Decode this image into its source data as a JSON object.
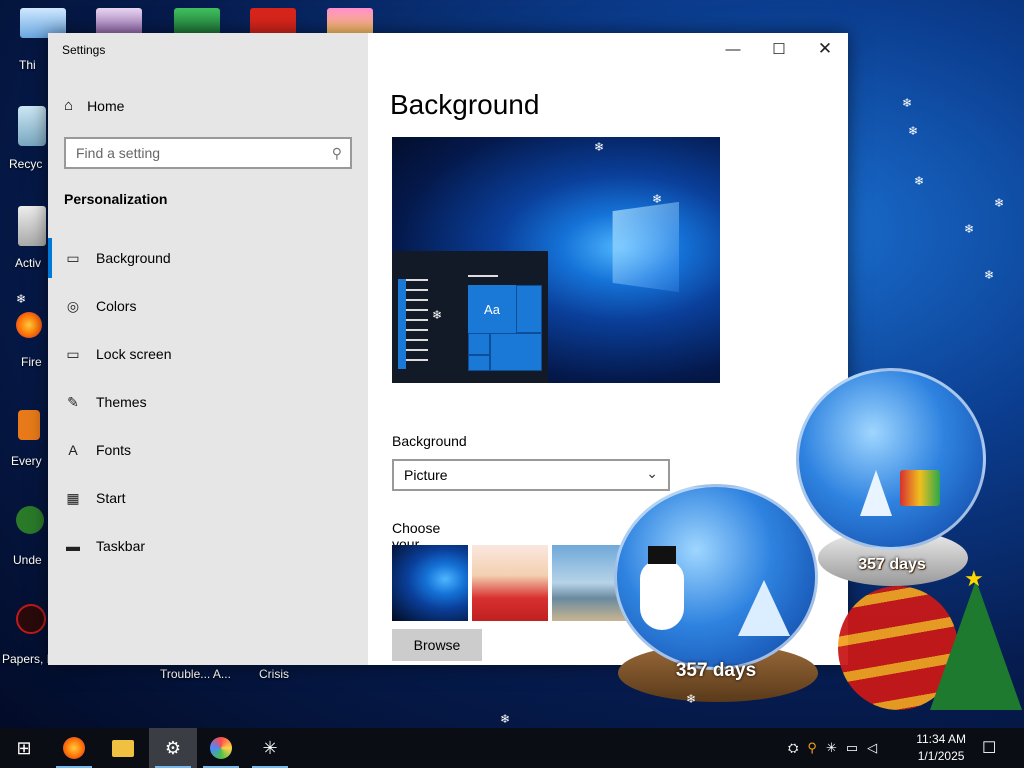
{
  "desktop": {
    "icons": [
      {
        "label": "Thi"
      },
      {
        "label": "Recyc"
      },
      {
        "label": "Activ"
      },
      {
        "label": "Fire"
      },
      {
        "label": "Every"
      },
      {
        "label": "Unde"
      },
      {
        "label": "Papers, P"
      }
    ],
    "bottom_labels": [
      "Trouble... A...",
      "Crisis"
    ]
  },
  "window": {
    "title": "Settings",
    "home_label": "Home",
    "search_placeholder": "Find a setting",
    "section": "Personalization",
    "nav": [
      {
        "label": "Background",
        "icon": "picture-icon",
        "active": true
      },
      {
        "label": "Colors",
        "icon": "palette-icon"
      },
      {
        "label": "Lock screen",
        "icon": "lock-screen-icon"
      },
      {
        "label": "Themes",
        "icon": "brush-icon"
      },
      {
        "label": "Fonts",
        "icon": "font-icon"
      },
      {
        "label": "Start",
        "icon": "start-icon"
      },
      {
        "label": "Taskbar",
        "icon": "taskbar-icon"
      }
    ],
    "main": {
      "heading": "Background",
      "preview_tile_text": "Aa",
      "background_label": "Background",
      "background_value": "Picture",
      "choose_label": "Choose your picture",
      "browse_label": "Browse"
    }
  },
  "widgets": {
    "globe_days_right": "357 days",
    "globe_days_center": "357 days"
  },
  "taskbar": {
    "time": "11:34 AM",
    "date": "1/1/2025",
    "items": [
      "start-icon",
      "firefox-icon",
      "file-explorer-icon",
      "settings-icon",
      "colorful-app-icon",
      "snowflake-app-icon"
    ],
    "active_item": "settings-icon"
  },
  "colors": {
    "accent": "#0078d7",
    "sidebar_bg": "#e6e6e6",
    "taskbar_bg": "#0a0d14"
  }
}
